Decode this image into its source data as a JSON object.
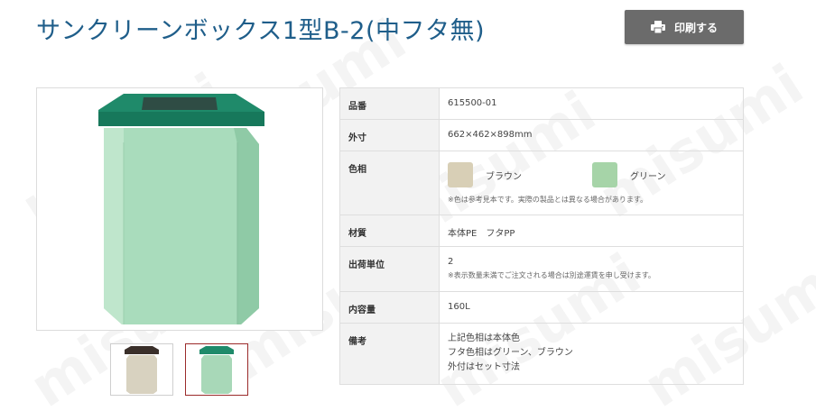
{
  "page": {
    "title": "サンクリーンボックス1型B-2(中フタ無)"
  },
  "actions": {
    "print_label": "印刷する",
    "print_icon": "printer-icon"
  },
  "watermark": {
    "text": "misumi"
  },
  "gallery": {
    "thumbnails": [
      {
        "name": "thumbnail-brown",
        "lid_color": "#3a2f2a",
        "body_color": "#d8d2c0"
      },
      {
        "name": "thumbnail-green",
        "lid_color": "#1f8a6a",
        "body_color": "#a8d8b8",
        "selected": true
      }
    ]
  },
  "specs": {
    "rows": [
      {
        "label": "品番",
        "value": "615500-01"
      },
      {
        "label": "外寸",
        "value": "662×462×898mm"
      },
      {
        "label": "色相",
        "colors": [
          {
            "name": "ブラウン",
            "hex": "#d8cfb6"
          },
          {
            "name": "グリーン",
            "hex": "#a6d4a8"
          }
        ],
        "note": "※色は参考見本です。実際の製品とは異なる場合があります。"
      },
      {
        "label": "材質",
        "value": "本体PE　フタPP"
      },
      {
        "label": "出荷単位",
        "value": "2",
        "note": "※表示数量未満でご注文される場合は別途運賃を申し受けます。"
      },
      {
        "label": "内容量",
        "value": "160L"
      },
      {
        "label": "備考",
        "lines": [
          "上記色相は本体色",
          "フタ色相はグリーン、ブラウン",
          "外付はセット寸法"
        ]
      }
    ]
  }
}
